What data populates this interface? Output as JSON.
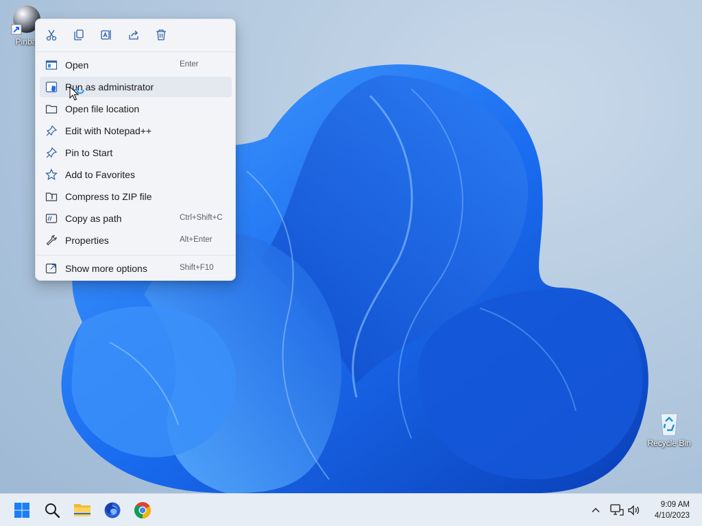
{
  "desktop": {
    "icons": [
      {
        "label": "Pinba",
        "icon": "pinball-icon"
      },
      {
        "label": "Recycle Bin",
        "icon": "recycle-bin-icon"
      }
    ]
  },
  "context_menu": {
    "quick_actions": [
      {
        "name": "Cut",
        "icon": "cut-icon"
      },
      {
        "name": "Copy",
        "icon": "copy-icon"
      },
      {
        "name": "Rename",
        "icon": "rename-icon"
      },
      {
        "name": "Share",
        "icon": "share-icon"
      },
      {
        "name": "Delete",
        "icon": "delete-icon"
      }
    ],
    "items": [
      {
        "label": "Open",
        "shortcut": "Enter",
        "icon": "open-icon"
      },
      {
        "label": "Run as administrator",
        "shortcut": "",
        "icon": "shield-icon",
        "hovered": true
      },
      {
        "label": "Open file location",
        "shortcut": "",
        "icon": "folder-icon"
      },
      {
        "label": "Edit with Notepad++",
        "shortcut": "",
        "icon": "pin-icon"
      },
      {
        "label": "Pin to Start",
        "shortcut": "",
        "icon": "pin-icon"
      },
      {
        "label": "Add to Favorites",
        "shortcut": "",
        "icon": "star-icon"
      },
      {
        "label": "Compress to ZIP file",
        "shortcut": "",
        "icon": "zip-icon"
      },
      {
        "label": "Copy as path",
        "shortcut": "Ctrl+Shift+C",
        "icon": "path-icon"
      },
      {
        "label": "Properties",
        "shortcut": "Alt+Enter",
        "icon": "wrench-icon"
      }
    ],
    "more": {
      "label": "Show more options",
      "shortcut": "Shift+F10",
      "icon": "external-icon"
    }
  },
  "taskbar": {
    "apps": [
      {
        "name": "Start",
        "icon": "windows-logo-icon"
      },
      {
        "name": "Search",
        "icon": "search-icon"
      },
      {
        "name": "File Explorer",
        "icon": "file-explorer-icon"
      },
      {
        "name": "Firefox",
        "icon": "firefox-icon"
      },
      {
        "name": "Chrome",
        "icon": "chrome-icon"
      }
    ],
    "tray": {
      "icons": [
        "chevron-up-icon",
        "network-icon",
        "volume-icon"
      ],
      "time": "9:09 AM",
      "date": "4/10/2023"
    }
  },
  "colors": {
    "accent": "#0067c0",
    "menu_bg": "#f2f4f8",
    "taskbar_bg": "#e7edf5",
    "bloom_blue": "#1a6cf0"
  }
}
